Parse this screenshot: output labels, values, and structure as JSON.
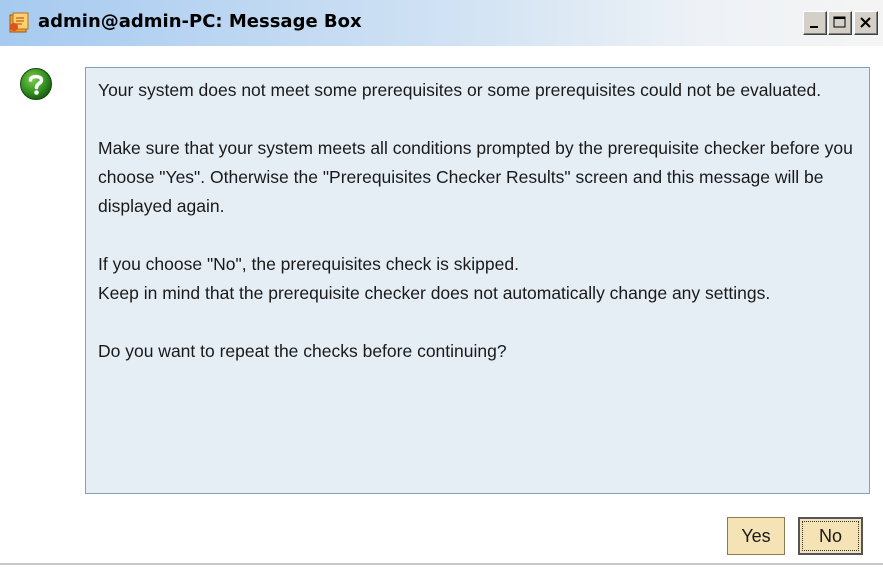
{
  "window": {
    "title": "admin@admin-PC: Message Box",
    "controls": {
      "minimize_icon": "minimize-icon",
      "maximize_icon": "maximize-icon",
      "close_icon": "close-icon"
    }
  },
  "message": {
    "icon": "question-icon",
    "paragraphs": [
      "Your system does not meet some prerequisites or some prerequisites could not be evaluated.",
      "Make sure that your system meets all conditions prompted by the prerequisite checker before you choose \"Yes\". Otherwise the \"Prerequisites Checker Results\" screen and this message will be displayed again.",
      "If you choose \"No\", the prerequisites check is skipped.\nKeep in mind that the prerequisite checker does not automatically change any settings.",
      "Do you want to repeat the checks before continuing?"
    ]
  },
  "buttons": {
    "yes_label": "Yes",
    "no_label": "No"
  },
  "colors": {
    "titlebar_start": "#a6caf0",
    "message_bg": "#e6eef5",
    "message_border": "#7fa0bf",
    "button_bg": "#f5e3b5",
    "question_icon": "#2e8b1e"
  }
}
